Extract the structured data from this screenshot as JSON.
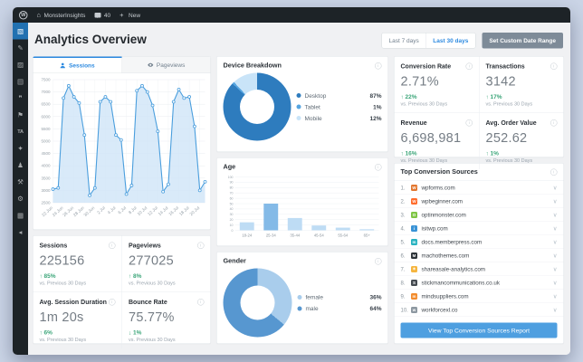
{
  "admin_bar": {
    "site_name": "MonsterInsights",
    "comments_count": "40",
    "new_label": "New"
  },
  "sidebar": {
    "items": [
      {
        "name": "dashboard",
        "glyph": "▧",
        "active": true
      },
      {
        "name": "posts",
        "glyph": "✎"
      },
      {
        "name": "media",
        "glyph": "▨"
      },
      {
        "name": "pages",
        "glyph": "▤"
      },
      {
        "name": "comments",
        "glyph": "❞"
      },
      {
        "name": "appearance",
        "glyph": "⚑"
      },
      {
        "name": "ta",
        "glyph": "TA"
      },
      {
        "name": "plugins",
        "glyph": "✦"
      },
      {
        "name": "users",
        "glyph": "♟"
      },
      {
        "name": "tools",
        "glyph": "⚒"
      },
      {
        "name": "settings",
        "glyph": "⚙"
      },
      {
        "name": "insights",
        "glyph": "▦"
      },
      {
        "name": "collapse",
        "glyph": "◂"
      }
    ]
  },
  "header": {
    "title": "Analytics Overview",
    "range_buttons": [
      {
        "label": "Last 7 days",
        "active": false
      },
      {
        "label": "Last 30 days",
        "active": true
      }
    ],
    "custom_range_label": "Set Custom Date Range"
  },
  "tabs": {
    "sessions": "Sessions",
    "pageviews": "Pageviews"
  },
  "colors": {
    "accent_blue": "#2d8ae0",
    "button_blue": "#4e9fe0",
    "green": "#3aa578",
    "admin_dark": "#1d2327"
  },
  "chart_data": [
    {
      "id": "sessions",
      "type": "line",
      "title": "Sessions over last 30 days",
      "x": [
        "22 Jun",
        "23 Jun",
        "24 Jun",
        "25 Jun",
        "26 Jun",
        "27 Jun",
        "28 Jun",
        "29 Jun",
        "30 Jun",
        "1 Jul",
        "2 Jul",
        "3 Jul",
        "4 Jul",
        "5 Jul",
        "6 Jul",
        "7 Jul",
        "8 Jul",
        "9 Jul",
        "10 Jul",
        "11 Jul",
        "12 Jul",
        "13 Jul",
        "14 Jul",
        "15 Jul",
        "16 Jul",
        "17 Jul",
        "18 Jul",
        "19 Jul",
        "20 Jul",
        "21 Jul"
      ],
      "values": [
        3050,
        3100,
        6750,
        7250,
        6800,
        6550,
        5250,
        2800,
        3100,
        6600,
        6800,
        6600,
        5250,
        5050,
        2850,
        3200,
        7050,
        7250,
        7000,
        6450,
        5400,
        2950,
        3250,
        6600,
        7100,
        6750,
        6800,
        5600,
        3000,
        3350
      ],
      "ylim": [
        2500,
        7500
      ],
      "ytick": 500,
      "label_every": 2,
      "line_color": "#4a9edd",
      "fill_color": "#cfe5f7",
      "grid": true,
      "legend": "none"
    },
    {
      "id": "device",
      "type": "pie",
      "title": "Device Breakdown",
      "slices": [
        {
          "label": "Desktop",
          "value": 87,
          "pct": "87%",
          "color": "#2e7cbe"
        },
        {
          "label": "Tablet",
          "value": 1,
          "pct": "1%",
          "color": "#56a5e0"
        },
        {
          "label": "Mobile",
          "value": 12,
          "pct": "12%",
          "color": "#c9e4f8"
        }
      ],
      "legend": "right"
    },
    {
      "id": "age",
      "type": "bar",
      "title": "Age",
      "categories": [
        "18-24",
        "25-34",
        "35-44",
        "45-54",
        "55-64",
        "65+"
      ],
      "values": [
        15,
        50,
        23,
        9,
        5,
        2
      ],
      "ylim": [
        0,
        100
      ],
      "ytick": 10,
      "highlight_index": 1,
      "bar_color": "#bedcf4",
      "highlight_color": "#84bae7",
      "grid": true
    },
    {
      "id": "gender",
      "type": "pie",
      "title": "Gender",
      "slices": [
        {
          "label": "female",
          "value": 36,
          "pct": "36%",
          "color": "#a9cdec"
        },
        {
          "label": "male",
          "value": 64,
          "pct": "64%",
          "color": "#5797d0"
        }
      ],
      "legend": "right"
    }
  ],
  "panels": {
    "device_title": "Device Breakdown",
    "age_title": "Age",
    "gender_title": "Gender"
  },
  "metrics_left": [
    {
      "id": "sessions",
      "title": "Sessions",
      "value": "225156",
      "change": "85%",
      "direction": "up",
      "sub": "vs. Previous 30 Days"
    },
    {
      "id": "pageviews",
      "title": "Pageviews",
      "value": "277025",
      "change": "8%",
      "direction": "up",
      "sub": "vs. Previous 30 Days"
    },
    {
      "id": "avg-session-duration",
      "title": "Avg. Session Duration",
      "value": "1m 20s",
      "change": "6%",
      "direction": "up",
      "sub": "vs. Previous 30 Days"
    },
    {
      "id": "bounce-rate",
      "title": "Bounce Rate",
      "value": "75.77%",
      "change": "1%",
      "direction": "down",
      "sub": "vs. Previous 30 Days"
    }
  ],
  "metrics_right": [
    {
      "id": "conversion-rate",
      "title": "Conversion Rate",
      "value": "2.71%",
      "change": "22%",
      "direction": "up",
      "sub": "vs. Previous 30 Days"
    },
    {
      "id": "transactions",
      "title": "Transactions",
      "value": "3142",
      "change": "17%",
      "direction": "up",
      "sub": "vs. Previous 30 Days"
    },
    {
      "id": "revenue",
      "title": "Revenue",
      "value": "6,698,981",
      "change": "16%",
      "direction": "up",
      "sub": "vs. Previous 30 Days"
    },
    {
      "id": "avg-order-value",
      "title": "Avg. Order Value",
      "value": "252.62",
      "change": "1%",
      "direction": "up",
      "sub": "vs. Previous 30 Days"
    }
  ],
  "sources": {
    "title": "Top Conversion Sources",
    "items": [
      {
        "rank": "1.",
        "domain": "wpforms.com",
        "color": "#e27730",
        "letter": "W"
      },
      {
        "rank": "2.",
        "domain": "wpbeginner.com",
        "color": "#ff6c2c",
        "letter": "W"
      },
      {
        "rank": "3.",
        "domain": "optinmonster.com",
        "color": "#7ec544",
        "letter": "O"
      },
      {
        "rank": "4.",
        "domain": "isitwp.com",
        "color": "#3a93d6",
        "letter": "i"
      },
      {
        "rank": "5.",
        "domain": "docs.memberpress.com",
        "color": "#27b2c0",
        "letter": "m"
      },
      {
        "rank": "6.",
        "domain": "machothemes.com",
        "color": "#2c3338",
        "letter": "M"
      },
      {
        "rank": "7.",
        "domain": "shareasale-analytics.com",
        "color": "#f5b53f",
        "letter": "✶"
      },
      {
        "rank": "8.",
        "domain": "stickmancommunications.co.uk",
        "color": "#444a50",
        "letter": "S"
      },
      {
        "rank": "9.",
        "domain": "mindsuppliers.com",
        "color": "#f28b2c",
        "letter": "m"
      },
      {
        "rank": "10.",
        "domain": "workforcexl.co",
        "color": "#8d98a1",
        "letter": "w"
      }
    ],
    "button_label": "View Top Conversion Sources Report"
  }
}
